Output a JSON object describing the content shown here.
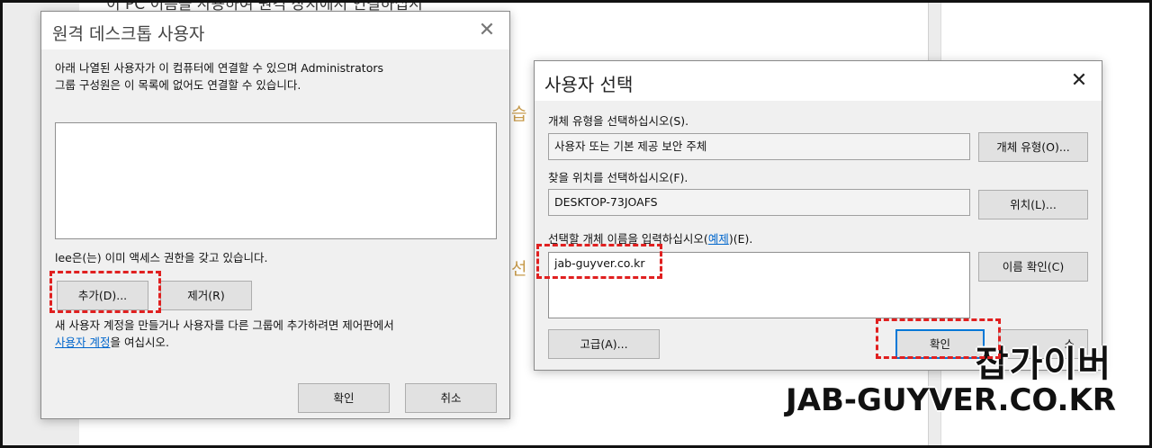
{
  "background": {
    "top_line": "이 PC 이름을 사용하여 원격 장치에서 연결하십시",
    "side_chars": [
      "습",
      "선"
    ]
  },
  "rdp_dialog": {
    "title": "원격 데스크톱 사용자",
    "close_icon": "close-icon",
    "description_line1": "아래 나열된 사용자가 이 컴퓨터에 연결할 수 있으며 Administrators",
    "description_line2": "그룹 구성원은 이 목록에 없어도 연결할 수 있습니다.",
    "users": [],
    "access_note": "lee은(는) 이미 액세스 권한을 갖고 있습니다.",
    "add_label": "추가(D)...",
    "remove_label": "제거(R)",
    "footer_line1": "새 사용자 계정을 만들거나 사용자를 다른 그룹에 추가하려면 제어판에서",
    "footer_link": "사용자 계정",
    "footer_line2_suffix": "을 여십시오.",
    "ok_label": "확인",
    "cancel_label": "취소"
  },
  "select_user_dialog": {
    "title": "사용자 선택",
    "close_icon": "close-icon",
    "object_type_label": "개체 유형을 선택하십시오(S).",
    "object_type_value": "사용자 또는 기본 제공 보안 주체",
    "object_type_button": "개체 유형(O)...",
    "location_label": "찾을 위치를 선택하십시오(F).",
    "location_value": "DESKTOP-73JOAFS",
    "location_button": "위치(L)...",
    "name_label_prefix": "선택할 개체 이름을 입력하십시오(",
    "name_label_link": "예제",
    "name_label_suffix": ")(E).",
    "name_value": "jab-guyver.co.kr",
    "check_names_button": "이름 확인(C)",
    "advanced_button": "고급(A)...",
    "ok_label": "확인",
    "cancel_partial": "소"
  },
  "watermark": {
    "korean": "잡가이버",
    "english": "JAB-GUYVER.CO.KR"
  },
  "colors": {
    "highlight": "#e02020",
    "link": "#0066cc",
    "dialog_bg": "#f0f0f0",
    "focus_border": "#0078d7"
  }
}
